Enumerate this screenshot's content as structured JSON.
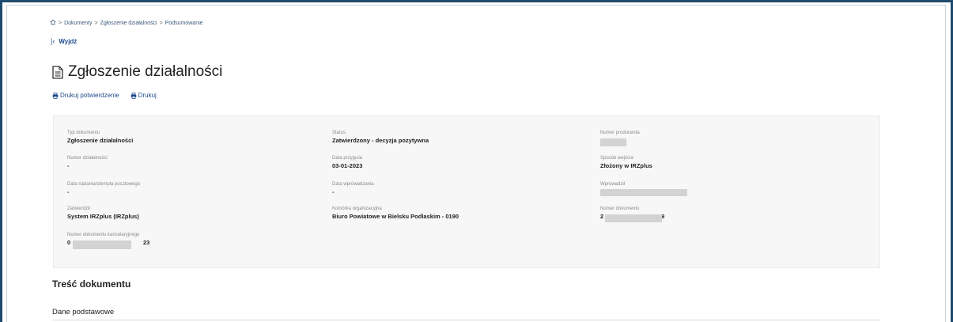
{
  "breadcrumb": {
    "home_icon": "home-icon",
    "items": [
      "Dokumenty",
      "Zgłoszenie działalności",
      "Podsumowanie"
    ],
    "separator": ">"
  },
  "nav": {
    "exit_label": "Wyjdź",
    "exit_icon": "chevron-left-icon"
  },
  "header": {
    "title": "Zgłoszenie działalności",
    "icon": "document-icon"
  },
  "actions": {
    "print_confirmation": "Drukuj potwierdzenie",
    "print": "Drukuj",
    "icon": "printer-icon"
  },
  "details": {
    "col1": [
      {
        "label": "Typ dokumentu",
        "value": "Zgłoszenie działalności"
      },
      {
        "label": "Numer działalności",
        "value": "-"
      },
      {
        "label": "Data nadania/stempla pocztowego",
        "value": "-"
      },
      {
        "label": "Zatwierdził",
        "value": "System IRZplus (IRZplus)"
      },
      {
        "label": "Numer dokumentu kancelaryjnego",
        "value_start": "0",
        "value_end": "23"
      }
    ],
    "col2": [
      {
        "label": "Status",
        "value": "Zatwierdzony - decyzja pozytywna"
      },
      {
        "label": "Data przyjęcia",
        "value": "03-01-2023"
      },
      {
        "label": "Data wprowadzania",
        "value": "-"
      },
      {
        "label": "Komórka organizacyjna",
        "value": "Biuro Powiatowe w Bielsku Podlaskim - 0190"
      }
    ],
    "col3": [
      {
        "label": "Numer producenta"
      },
      {
        "label": "Sposób wejścia",
        "value": "Złożony w IRZplus"
      },
      {
        "label": "Wprowadził"
      },
      {
        "label": "Numer dokumentu",
        "value_start": "2",
        "value_end": "9"
      }
    ]
  },
  "content": {
    "section_title": "Treść dokumentu",
    "subsection_title": "Dane podstawowe"
  },
  "colors": {
    "link": "#1f4b8e",
    "frame": "#1f4b6e",
    "panel_bg": "#f7f7f7"
  }
}
